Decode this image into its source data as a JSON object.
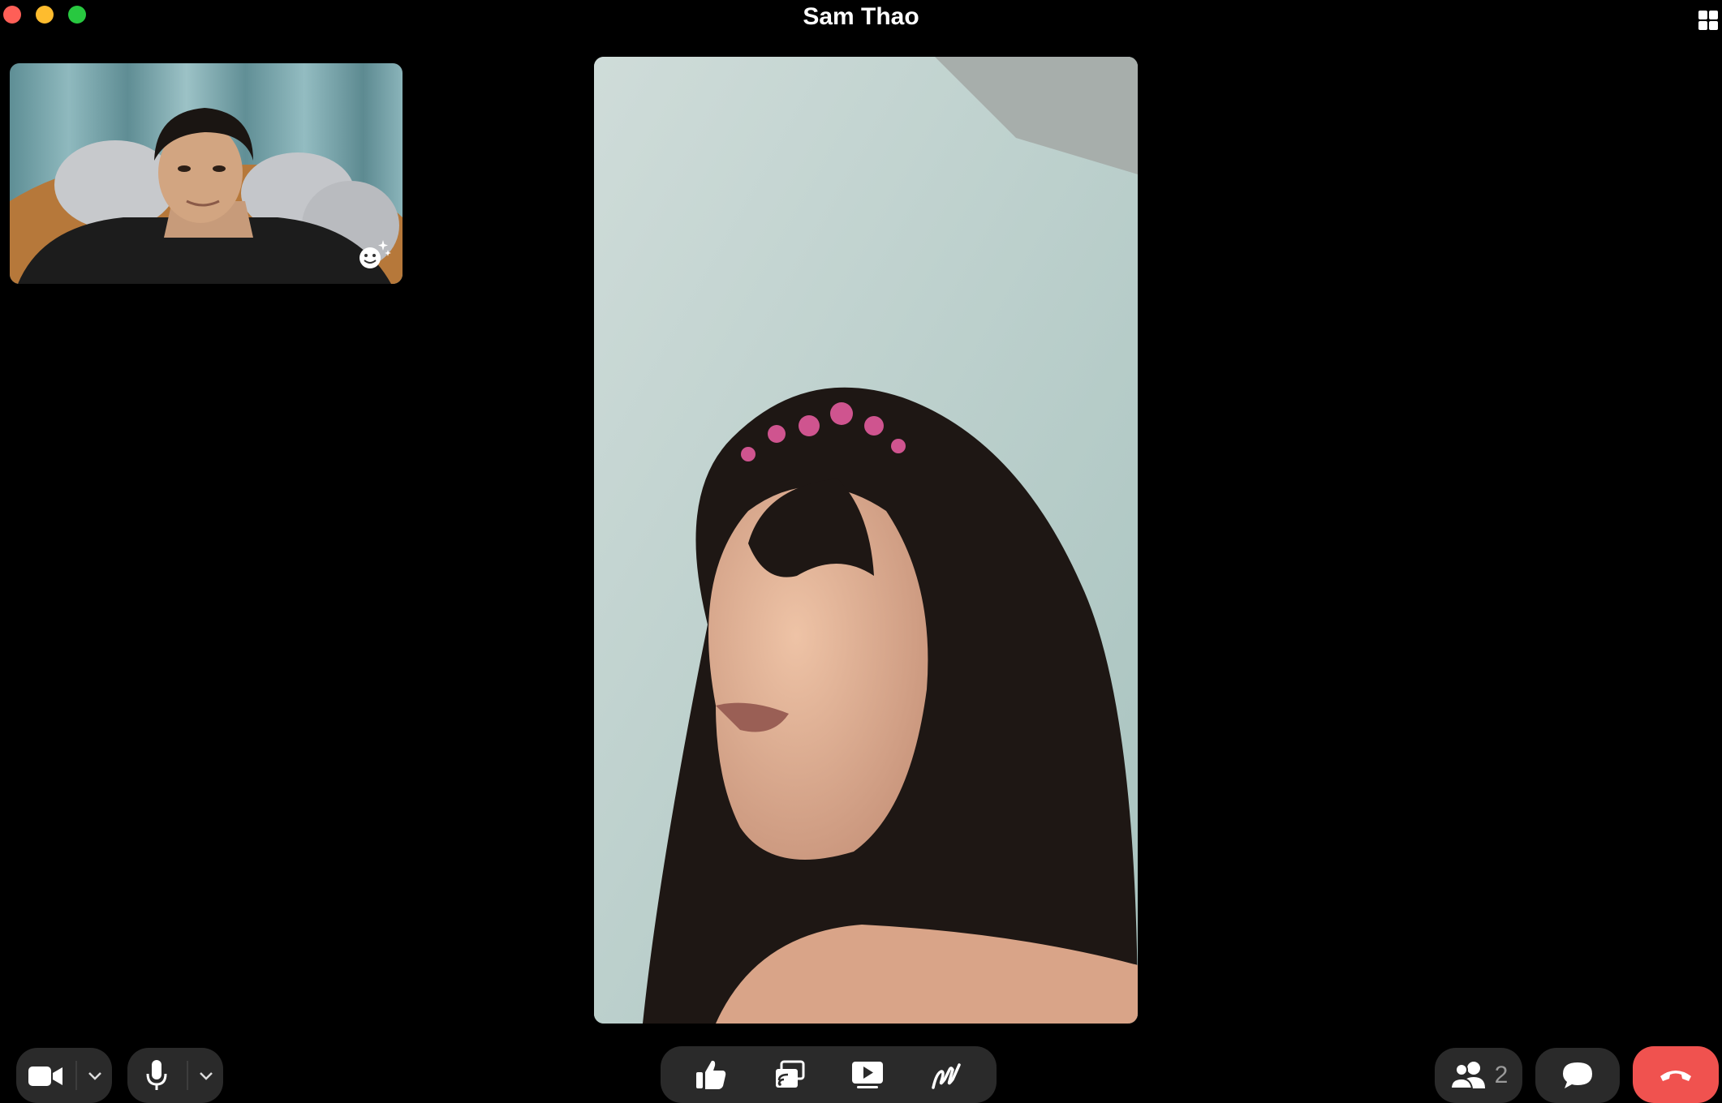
{
  "window": {
    "title": "Sam Thao"
  },
  "participants": {
    "count": "2"
  },
  "icons": {
    "close": "close-dot",
    "minimize": "minimize-dot",
    "maximize": "maximize-dot",
    "layout": "grid-icon",
    "effects": "smiley-sparkle-icon",
    "camera": "video-camera-icon",
    "mic": "microphone-icon",
    "reaction": "thumbs-up-icon",
    "screen_share": "screen-share-icon",
    "watch": "play-icon",
    "draw": "draw-icon",
    "people": "people-icon",
    "chat": "chat-bubble-icon",
    "end_call": "phone-hangup-icon"
  },
  "colors": {
    "end_call": "#f0524f",
    "control_bg": "#2a2a2a",
    "background": "#000000"
  }
}
